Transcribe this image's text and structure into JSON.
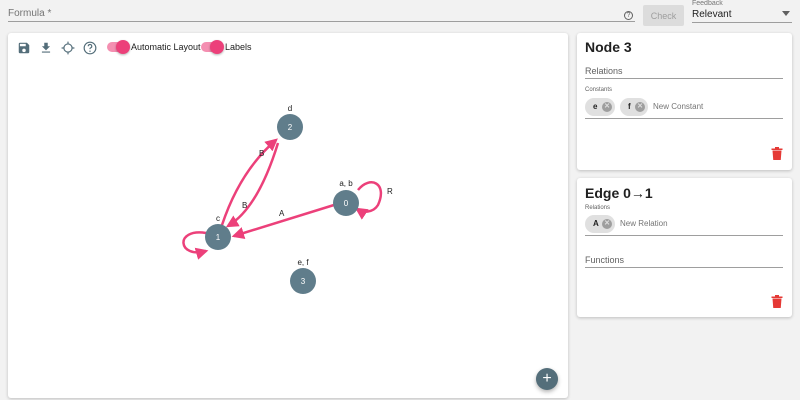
{
  "topbar": {
    "formula_label": "Formula *",
    "check_label": "Check",
    "feedback_caption": "Feedback",
    "feedback_value": "Relevant",
    "help_glyph": "?"
  },
  "toolbar": {
    "icons": [
      "save-icon",
      "download-icon",
      "crosshair-icon",
      "help-icon"
    ],
    "automatic_layout_label": "Automatic Layout",
    "automatic_layout_on": true,
    "labels_label": "Labels",
    "labels_on": true,
    "accent_color": "#ec407a"
  },
  "graph": {
    "node_color": "#607d8b",
    "edge_color": "#ec407a",
    "nodes": [
      {
        "id": "0",
        "constants": "a, b"
      },
      {
        "id": "1",
        "constants": "c"
      },
      {
        "id": "2",
        "constants": "d"
      },
      {
        "id": "3",
        "constants": "e, f"
      }
    ],
    "edges": [
      {
        "from": "0",
        "to": "0",
        "label": "R"
      },
      {
        "from": "0",
        "to": "1",
        "label": "A"
      },
      {
        "from": "1",
        "to": "1",
        "label": ""
      },
      {
        "from": "1",
        "to": "2",
        "label": "B"
      },
      {
        "from": "2",
        "to": "1",
        "label": "B"
      }
    ],
    "fab_label": "+"
  },
  "node_card": {
    "title": "Node 3",
    "relations_label": "Relations",
    "constants_label": "Constants",
    "constants": [
      "e",
      "f"
    ],
    "new_constant_placeholder": "New Constant"
  },
  "edge_card": {
    "title": "Edge 0→1",
    "relations_label": "Relations",
    "relations": [
      "A"
    ],
    "new_relation_placeholder": "New Relation",
    "functions_label": "Functions"
  },
  "delete_color": "#e53935"
}
